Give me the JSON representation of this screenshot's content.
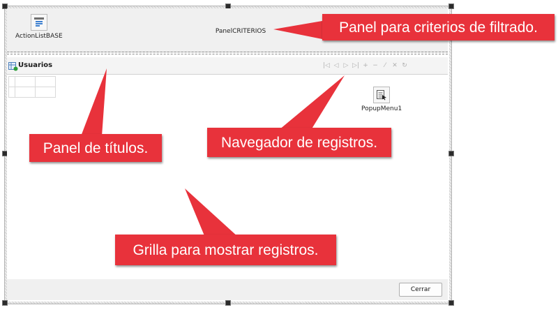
{
  "panel_criterios": {
    "component_label": "ActionListBASE",
    "caption": "PanelCRITERIOS"
  },
  "titles_panel": {
    "title": "Usuarios"
  },
  "navigator": {
    "icons": [
      "nav-first-icon",
      "nav-prior-icon",
      "nav-next-icon",
      "nav-last-icon",
      "nav-insert-icon",
      "nav-delete-icon",
      "nav-edit-icon",
      "nav-cancel-icon",
      "nav-refresh-icon"
    ]
  },
  "popup_menu": {
    "component_label": "PopupMenu1"
  },
  "footer": {
    "close_label": "Cerrar"
  },
  "callouts": {
    "criteria": "Panel para criterios de filtrado.",
    "titles": "Panel de títulos.",
    "navigator": "Navegador de registros.",
    "grid": "Grilla para mostrar registros."
  },
  "colors": {
    "callout": "#e8323b",
    "panel": "#f0f0f0"
  }
}
